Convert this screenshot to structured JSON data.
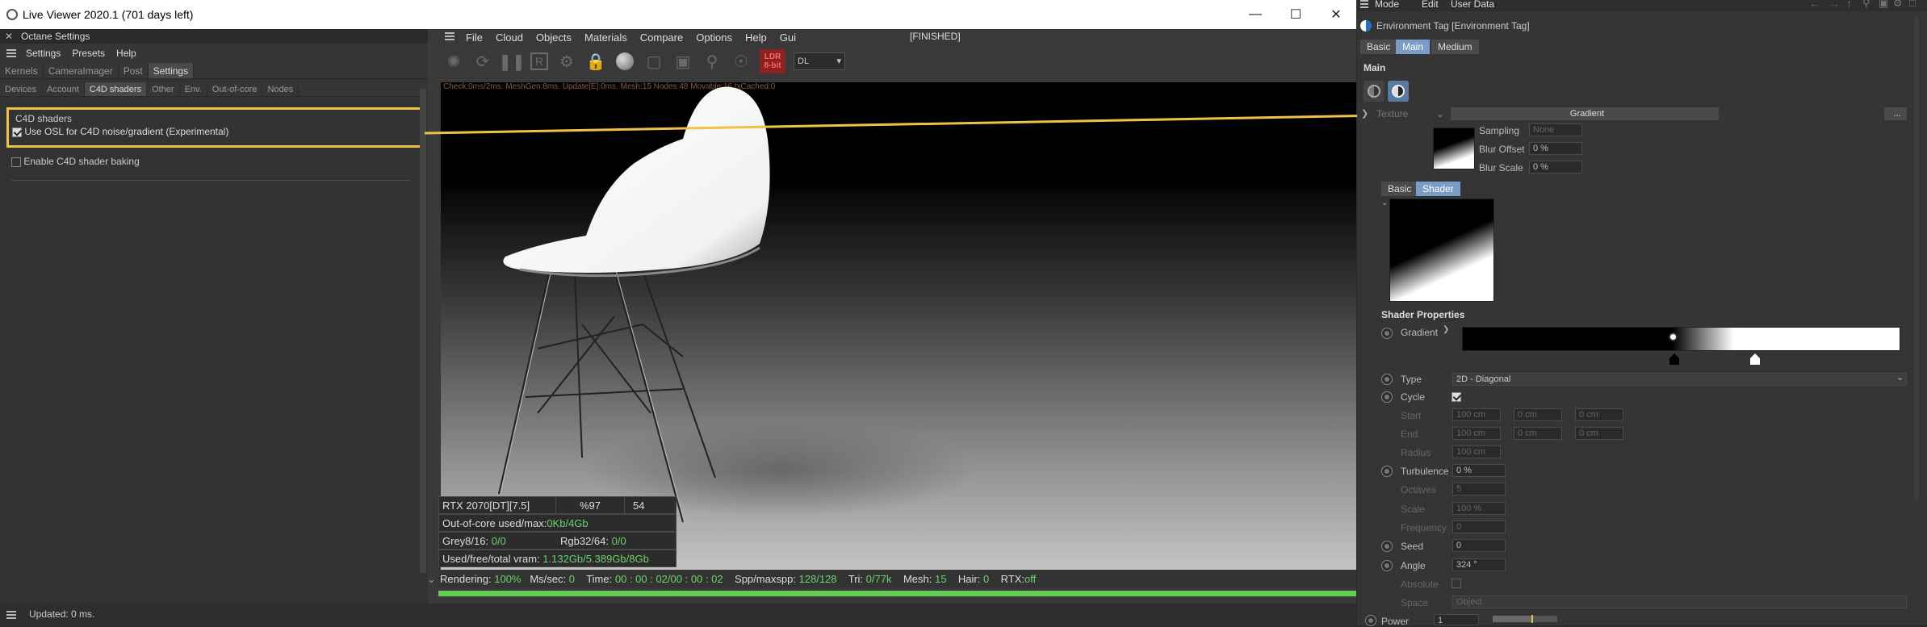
{
  "window": {
    "title": "Live Viewer 2020.1 (701 days left)"
  },
  "octane": {
    "panel_title": "Octane Settings",
    "menu": [
      "Settings",
      "Presets",
      "Help"
    ],
    "tabs1": [
      "Kernels",
      "CameraImager",
      "Post",
      "Settings"
    ],
    "tabs2": [
      "Devices",
      "Account",
      "C4D shaders",
      "Other",
      "Env.",
      "Out-of-core",
      "Nodes"
    ],
    "group_title": "C4D shaders",
    "osl_option": "Use OSL for C4D noise/gradient (Experimental)",
    "osl_checked": true,
    "baking_option": "Enable C4D shader baking",
    "baking_checked": false,
    "status": "Updated: 0 ms."
  },
  "viewer": {
    "menu": [
      "File",
      "Cloud",
      "Objects",
      "Materials",
      "Compare",
      "Options",
      "Help",
      "Gui"
    ],
    "state": "[FINISHED]",
    "mode": "DL",
    "ldr_badge": [
      "LDR",
      "8-bit"
    ],
    "debug": "Check:0ms/2ms. MeshGen:8ms. Update[E]:0ms. Mesh:15 Nodes:48 Movable:16 txCached:0",
    "gpu": "RTX 2070[DT][7.5]",
    "gpu_pct": "%97",
    "gpu_temp": "54",
    "ooc_label": "Out-of-core used/max:",
    "ooc_value": "0Kb/4Gb",
    "grey_label": "Grey8/16:",
    "grey_value": "0/0",
    "rgb_label": "Rgb32/64:",
    "rgb_value": "0/0",
    "vram_label": "Used/free/total vram:",
    "vram_value": "1.132Gb/5.389Gb/8Gb",
    "status": {
      "rendering_label": "Rendering:",
      "rendering": "100%",
      "ms_label": "Ms/sec:",
      "ms": "0",
      "time_label": "Time:",
      "time": "00 : 00 : 02/00 : 00 : 02",
      "spp_label": "Spp/maxspp:",
      "spp": "128/128",
      "tri_label": "Tri:",
      "tri": "0/77k",
      "mesh_label": "Mesh:",
      "mesh": "15",
      "hair_label": "Hair:",
      "hair": "0",
      "rtx_label": "RTX:",
      "rtx": "off"
    },
    "progress": 1.0
  },
  "attr": {
    "menu": [
      "Mode",
      "Edit",
      "User Data"
    ],
    "object_title": "Environment Tag [Environment Tag]",
    "tabs": [
      "Basic",
      "Main",
      "Medium"
    ],
    "section": "Main",
    "texture_label": "Texture",
    "texture_value": "Gradient",
    "more_btn": "...",
    "sampling_label": "Sampling",
    "sampling_value": "None",
    "blur_offset_label": "Blur Offset",
    "blur_offset": "0 %",
    "blur_scale_label": "Blur Scale",
    "blur_scale": "0 %",
    "shader_tabs": [
      "Basic",
      "Shader"
    ],
    "props_title": "Shader Properties",
    "gradient_label": "Gradient",
    "type_label": "Type",
    "type_value": "2D - Diagonal",
    "cycle_label": "Cycle",
    "start_label": "Start",
    "end_label": "End",
    "radius_label": "Radius",
    "start_values": [
      "100 cm",
      "0 cm",
      "0 cm"
    ],
    "end_values": [
      "100 cm",
      "0 cm",
      "0 cm"
    ],
    "radius_value": "100 cm",
    "turbulence_label": "Turbulence",
    "turbulence_value": "0 %",
    "octaves_label": "Octaves",
    "octaves_value": "5",
    "scale_label": "Scale",
    "scale_value": "100 %",
    "frequency_label": "Frequency",
    "frequency_value": "0",
    "seed_label": "Seed",
    "seed_value": "0",
    "angle_label": "Angle",
    "angle_value": "324 °",
    "absolute_label": "Absolute",
    "space_label": "Space",
    "space_value": "Object",
    "power_label": "Power",
    "power_value": "1"
  },
  "colors": {
    "highlight": "#f1c142",
    "accent": "#7a9cc9",
    "status_green": "#6cd46c"
  }
}
